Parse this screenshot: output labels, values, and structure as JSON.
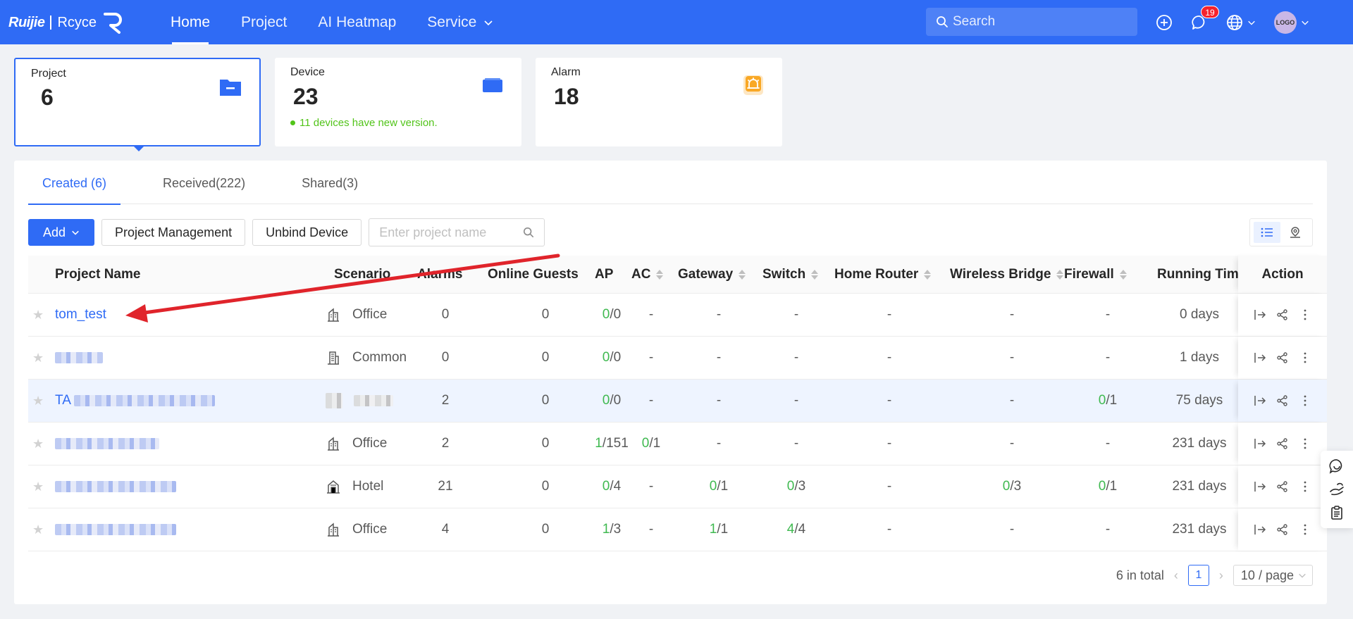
{
  "header": {
    "logo_brand": "Ruijie",
    "logo_product": "Rcyce",
    "nav": [
      {
        "label": "Home",
        "active": true
      },
      {
        "label": "Project",
        "active": false
      },
      {
        "label": "AI Heatmap",
        "active": false
      },
      {
        "label": "Service",
        "active": false,
        "has_dropdown": true
      }
    ],
    "search_placeholder": "Search",
    "messages_badge": "19",
    "avatar_text": "LOGO"
  },
  "stats": {
    "project": {
      "label": "Project",
      "value": "6",
      "icon": "folder-icon"
    },
    "device": {
      "label": "Device",
      "value": "23",
      "note": "11 devices have new version.",
      "icon": "device-icon"
    },
    "alarm": {
      "label": "Alarm",
      "value": "18",
      "icon": "alarm-icon"
    }
  },
  "tabs": [
    {
      "label": "Created (6)",
      "active": true
    },
    {
      "label": "Received(222)",
      "active": false
    },
    {
      "label": "Shared(3)",
      "active": false
    }
  ],
  "toolbar": {
    "add_label": "Add",
    "project_management_label": "Project Management",
    "unbind_device_label": "Unbind Device",
    "search_placeholder": "Enter project name"
  },
  "table": {
    "columns": [
      "Project Name",
      "Scenario",
      "Alarms",
      "Online Guests",
      "AP",
      "AC",
      "Gateway",
      "Switch",
      "Home Router",
      "Wireless Bridge",
      "Firewall",
      "Running Time",
      "Action"
    ],
    "rows": [
      {
        "name": "tom_test",
        "scenario": "Office",
        "alarms": "0",
        "guests": "0",
        "ap_on": "0",
        "ap_total": "/0",
        "ac": "-",
        "gateway": "-",
        "switch": "-",
        "home_router": "-",
        "bridge": "-",
        "firewall": "-",
        "running": "0 days"
      },
      {
        "name": "",
        "scenario": "Common",
        "alarms": "0",
        "guests": "0",
        "ap_on": "0",
        "ap_total": "/0",
        "ac": "-",
        "gateway": "-",
        "switch": "-",
        "home_router": "-",
        "bridge": "-",
        "firewall": "-",
        "running": "1 days"
      },
      {
        "name_prefix": "TA",
        "scenario": "",
        "alarms": "2",
        "guests": "0",
        "ap_on": "0",
        "ap_total": "/0",
        "ac": "-",
        "gateway": "-",
        "switch": "-",
        "home_router": "-",
        "bridge": "-",
        "fw_on": "0",
        "fw_total": "/1",
        "running": "75 days"
      },
      {
        "name": "",
        "scenario": "Office",
        "alarms": "2",
        "guests": "0",
        "ap_on": "1",
        "ap_total": "/151",
        "ac_on": "0",
        "ac_total": "/1",
        "gateway": "-",
        "switch": "-",
        "home_router": "-",
        "bridge": "-",
        "firewall": "-",
        "running": "231 days"
      },
      {
        "name": "",
        "scenario": "Hotel",
        "alarms": "21",
        "guests": "0",
        "ap_on": "0",
        "ap_total": "/4",
        "ac": "-",
        "gw_on": "0",
        "gw_total": "/1",
        "sw_on": "0",
        "sw_total": "/3",
        "home_router": "-",
        "br_on": "0",
        "br_total": "/3",
        "fw_on": "0",
        "fw_total": "/1",
        "running": "231 days"
      },
      {
        "name": "",
        "scenario": "Office",
        "alarms": "4",
        "guests": "0",
        "ap_on": "1",
        "ap_total": "/3",
        "ac": "-",
        "gw_on": "1",
        "gw_total": "/1",
        "sw_on": "4",
        "sw_total": "/4",
        "home_router": "-",
        "bridge": "-",
        "firewall": "-",
        "running": "231 days"
      }
    ]
  },
  "pagination": {
    "total_text": "6 in total",
    "current_page": "1",
    "page_size": "10 / page"
  },
  "colors": {
    "brand_blue": "#2f6bf5",
    "online_green": "#3fb950",
    "annotation_red": "#e0242b"
  }
}
